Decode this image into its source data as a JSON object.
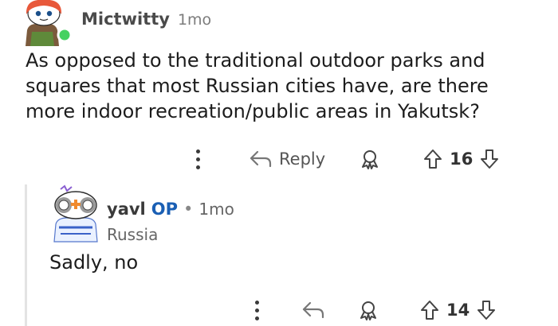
{
  "comment": {
    "author": "Mictwitty",
    "time": "1mo",
    "body": "As opposed to the traditional outdoor parks and squares that most Russian cities have, are there more indoor recreation/public areas in Yakutsk?",
    "actions": {
      "reply_label": "Reply",
      "score": "16"
    }
  },
  "reply": {
    "author": "yavl",
    "op_badge": "OP",
    "separator": "•",
    "time": "1mo",
    "flair": "Russia",
    "body": "Sadly, no",
    "actions": {
      "score": "14"
    }
  },
  "colors": {
    "online": "#46d160",
    "op_blue": "#1a5fb4",
    "thread_line": "#e3e3e3",
    "avatar_orange": "#e8583a"
  },
  "icons": {
    "more": "more-vertical-icon",
    "reply": "reply-arrow-icon",
    "award": "award-icon",
    "upvote": "upvote-arrow-icon",
    "downvote": "downvote-arrow-icon"
  }
}
